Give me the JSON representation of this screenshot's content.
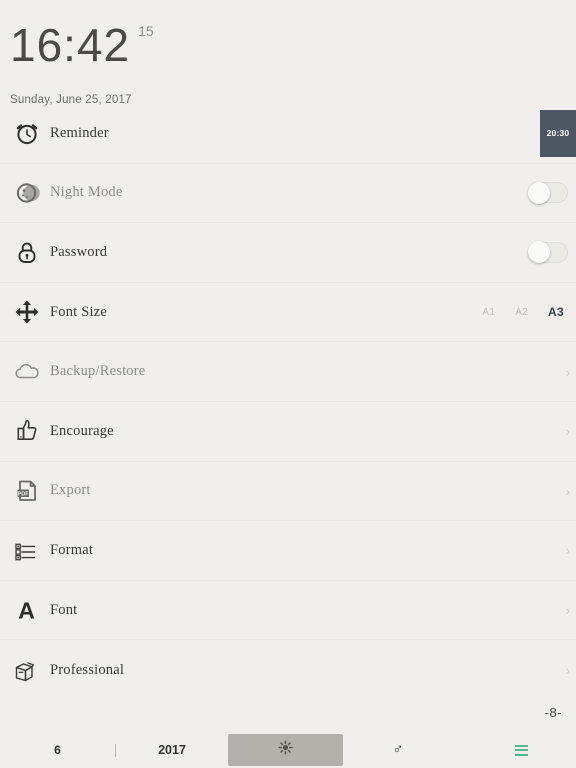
{
  "header": {
    "time": "16:42",
    "seconds": "15",
    "date": "Sunday, June 25, 2017"
  },
  "settings": {
    "rows": [
      {
        "label": "Reminder",
        "icon": "alarm-clock-icon",
        "control": "badge",
        "badge_value": "20:30",
        "badge_color": "#4c5763",
        "dim": false
      },
      {
        "label": "Night Mode",
        "icon": "moon-icon",
        "control": "toggle",
        "toggle_on": false,
        "dim": true
      },
      {
        "label": "Password",
        "icon": "padlock-icon",
        "control": "toggle",
        "toggle_on": false,
        "dim": false
      },
      {
        "label": "Font Size",
        "icon": "move-arrows-icon",
        "control": "fontsize",
        "dim": false
      },
      {
        "label": "Backup/Restore",
        "icon": "cloud-icon",
        "control": "chevron",
        "dim": true
      },
      {
        "label": "Encourage",
        "icon": "thumbs-up-icon",
        "control": "chevron",
        "dim": false
      },
      {
        "label": "Export",
        "icon": "pdf-file-icon",
        "control": "chevron",
        "dim": true
      },
      {
        "label": "Format",
        "icon": "list-format-icon",
        "control": "chevron",
        "dim": false
      },
      {
        "label": "Font",
        "icon": "letter-a-icon",
        "control": "chevron",
        "dim": false
      },
      {
        "label": "Professional",
        "icon": "package-box-icon",
        "control": "chevron",
        "dim": false
      }
    ],
    "font_size_options": [
      {
        "label": "A1",
        "selected": false
      },
      {
        "label": "A2",
        "selected": false
      },
      {
        "label": "A3",
        "selected": true
      }
    ],
    "chevron_glyph": "›"
  },
  "footer": {
    "page_indicator": "-8-",
    "month": "6",
    "divider": "|",
    "year": "2017",
    "center_icon": "sun-settings-icon",
    "symbol_glyph": "♂",
    "menu_icon": "hamburger-menu-icon",
    "menu_color": "#4fb894"
  }
}
